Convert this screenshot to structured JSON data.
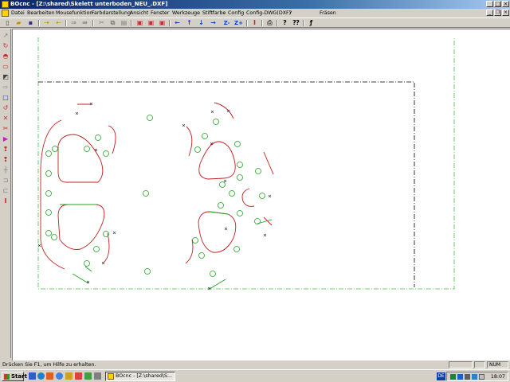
{
  "window": {
    "title": "BOcnc - [Z:\\shared\\Skelett unterboden_NEU_.DXF]"
  },
  "menu": {
    "items": [
      "Datei",
      "Bearbeiten",
      "Mousefunktion",
      "Farbdarstellung",
      "Ansicht",
      "Fenster",
      "Werkzeuge",
      "Stiftfarbe",
      "Config",
      "Config-DWG(DXF)",
      "?"
    ],
    "right_label": "Fräsen"
  },
  "toolbar": {
    "icons": [
      "new-icon",
      "open-icon",
      "save-icon",
      "copy-in-icon",
      "copy-out-icon",
      "forward-icon",
      "forward2-icon",
      "cut-icon",
      "copy-icon",
      "paste-icon",
      "zoom-box-icon",
      "zoom-window-icon",
      "zoom-all-icon",
      "arrow-left-icon",
      "arrow-up-icon",
      "arrow-down-icon",
      "arrow-right-icon",
      "z-minus-icon",
      "z-plus-icon",
      "tool-i-icon",
      "print-icon",
      "help-icon",
      "context-help-icon",
      "pen-icon"
    ],
    "z_minus_label": "Z-",
    "z_plus_label": "Z+",
    "tool_label": "I"
  },
  "statusbar": {
    "message": "Drücken Sie F1, um Hilfe zu erhalten.",
    "num_label": "NUM"
  },
  "taskbar": {
    "start_label": "Start",
    "task_item_label": "BOcnc - [Z:\\shared\\S...",
    "language": "DE",
    "clock": "18:07"
  },
  "colors": {
    "title_active": "#0a246a",
    "canvas_bg": "#ffffff",
    "contour_red": "#c02020",
    "contour_green": "#20a020",
    "border_green": "#40c040",
    "frame_black": "#000000"
  }
}
